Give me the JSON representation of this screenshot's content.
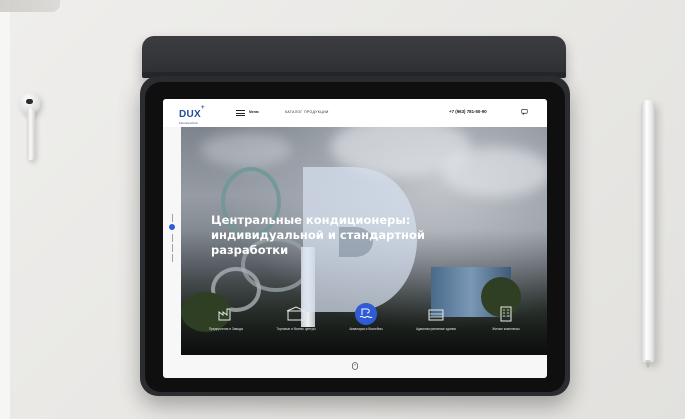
{
  "site": {
    "logo": "DUX",
    "logo_sup": "+",
    "logo_sub": "klimatechnik",
    "menu_label": "Меню",
    "catalog_label": "КАТАЛОГ ПРОДУКЦИИ",
    "phone": "+7 (963) 781-50-90"
  },
  "hero": {
    "title_lines": [
      "Центральные кондиционеры:",
      "индивидуальной и стандартной",
      "разработки"
    ],
    "categories": [
      {
        "label": "Предприятия и Заводы",
        "icon": "factory-icon",
        "active": false
      },
      {
        "label": "Торговые и бизнес центры",
        "icon": "mall-icon",
        "active": false
      },
      {
        "label": "Аквапарки и бассейны",
        "icon": "waterpark-icon",
        "active": true
      },
      {
        "label": "Административные здания",
        "icon": "office-building-icon",
        "active": false
      },
      {
        "label": "Жилые комплексы",
        "icon": "residential-icon",
        "active": false
      }
    ]
  },
  "colors": {
    "brand": "#234c9c",
    "accent": "#2f5bd4",
    "case": "#2b2c30"
  }
}
